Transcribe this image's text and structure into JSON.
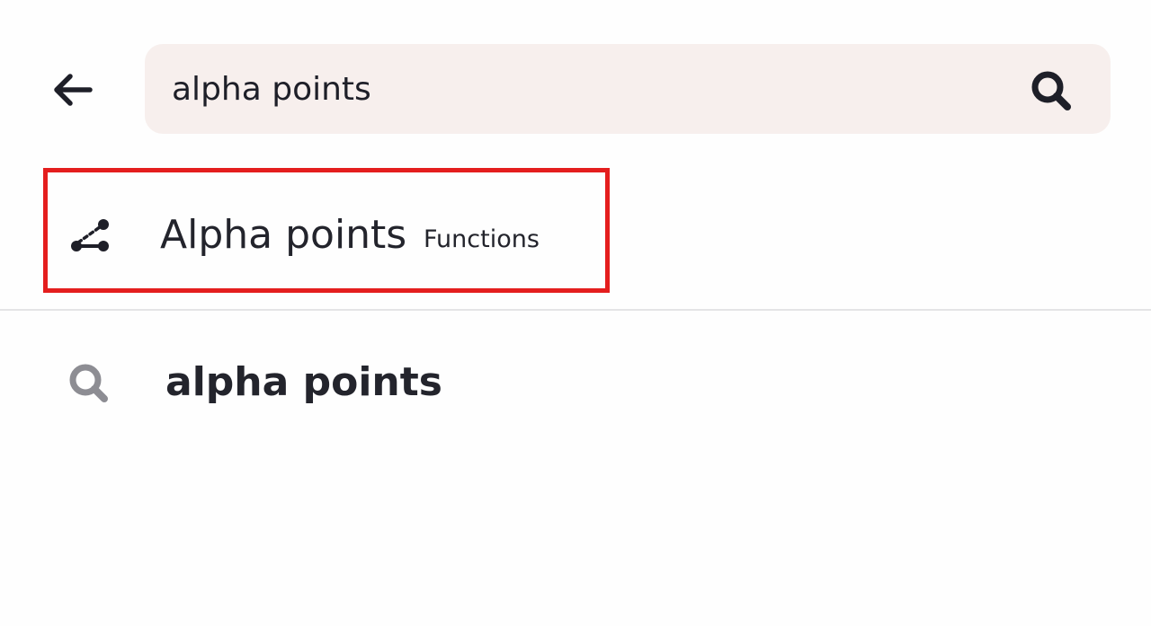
{
  "header": {
    "back_icon": "arrow-left-icon"
  },
  "search": {
    "value": "alpha points",
    "icon": "search-icon"
  },
  "results": [
    {
      "icon": "line-points-icon",
      "title": "Alpha points",
      "category": "Functions",
      "highlight_color": "#e41e1e"
    }
  ],
  "suggestions": [
    {
      "icon": "search-icon",
      "text": "alpha points"
    }
  ],
  "colors": {
    "search_bar_bg": "#f7efed",
    "text": "#23242c",
    "suggestion_icon": "#8d8d93"
  }
}
